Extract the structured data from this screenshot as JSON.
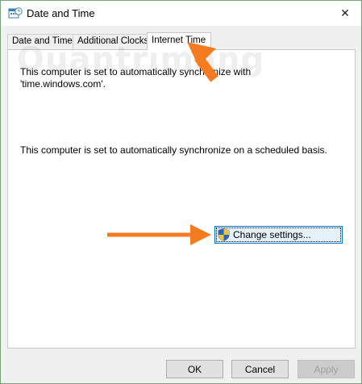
{
  "window": {
    "title": "Date and Time",
    "icon": "date-time-icon",
    "close_glyph": "✕"
  },
  "tabs": [
    {
      "label": "Date and Time",
      "active": false
    },
    {
      "label": "Additional Clocks",
      "active": false
    },
    {
      "label": "Internet Time",
      "active": true
    }
  ],
  "panel": {
    "message1": "This computer is set to automatically synchronize with 'time.windows.com'.",
    "message2": "This computer is set to automatically synchronize on a scheduled basis.",
    "change_settings_label": "Change settings..."
  },
  "footer": {
    "ok_label": "OK",
    "cancel_label": "Cancel",
    "apply_label": "Apply"
  },
  "watermark": "Quantrimang",
  "colors": {
    "arrow": "#f47b20",
    "focus_border": "#0078d7"
  }
}
